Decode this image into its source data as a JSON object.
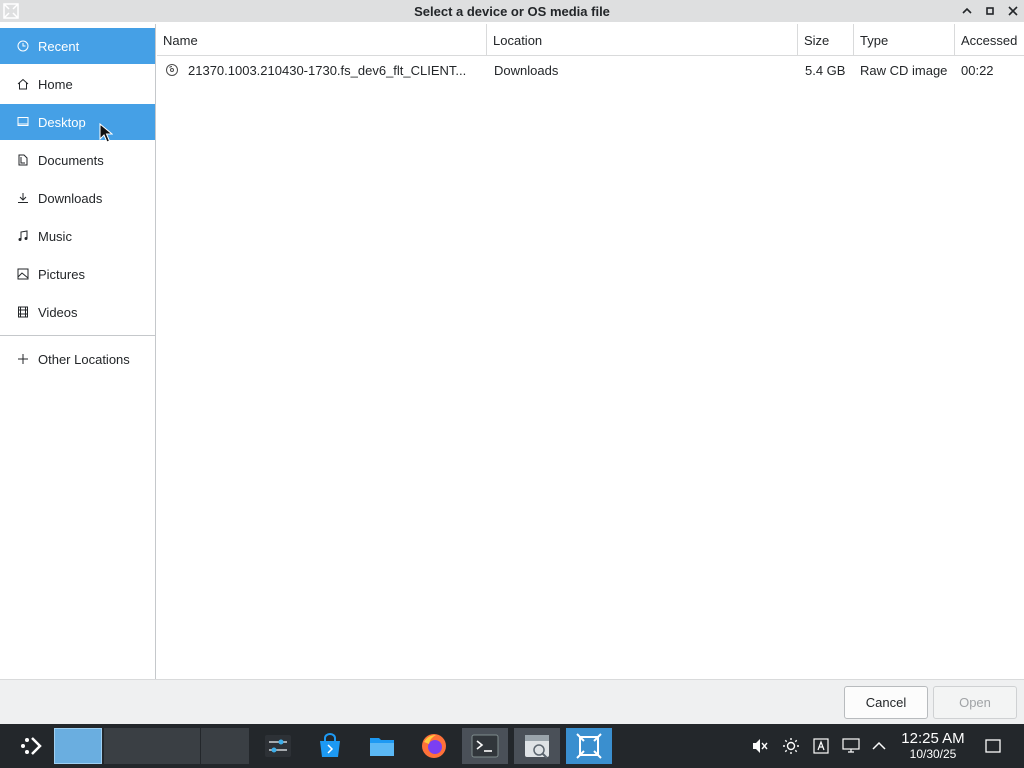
{
  "window": {
    "title": "Select a device or OS media file",
    "controls": [
      "minimize",
      "maximize",
      "close"
    ]
  },
  "sidebar": {
    "items": [
      {
        "label": "Recent",
        "icon": "clock-icon",
        "selected": true
      },
      {
        "label": "Home",
        "icon": "home-icon",
        "selected": false
      },
      {
        "label": "Desktop",
        "icon": "desktop-icon",
        "selected": true
      },
      {
        "label": "Documents",
        "icon": "documents-icon",
        "selected": false
      },
      {
        "label": "Downloads",
        "icon": "download-icon",
        "selected": false
      },
      {
        "label": "Music",
        "icon": "music-icon",
        "selected": false
      },
      {
        "label": "Pictures",
        "icon": "pictures-icon",
        "selected": false
      },
      {
        "label": "Videos",
        "icon": "video-icon",
        "selected": false
      }
    ],
    "other_locations": {
      "label": "Other Locations",
      "icon": "plus-icon"
    }
  },
  "file_list": {
    "columns": [
      "Name",
      "Location",
      "Size",
      "Type",
      "Accessed"
    ],
    "rows": [
      {
        "name": "21370.1003.210430-1730.fs_dev6_flt_CLIENT...",
        "location": "Downloads",
        "size": "5.4 GB",
        "type": "Raw CD image",
        "accessed": "00:22",
        "icon": "disc-image-icon"
      }
    ]
  },
  "footer": {
    "cancel_label": "Cancel",
    "open_label": "Open",
    "open_enabled": false
  },
  "taskbar": {
    "clock_time": "12:25 AM",
    "clock_date": "10/30/25",
    "apps": [
      "settings-app",
      "discover-store",
      "file-manager",
      "firefox",
      "terminal",
      "disk-utility",
      "imager"
    ],
    "tray": [
      "volume-muted-icon",
      "brightness-icon",
      "input-method-icon",
      "network-icon",
      "expand-tray-icon",
      "show-desktop-icon"
    ]
  },
  "colors": {
    "selection": "#45a0e6",
    "taskbar": "#23272b",
    "titlebar": "#dedfe0"
  }
}
